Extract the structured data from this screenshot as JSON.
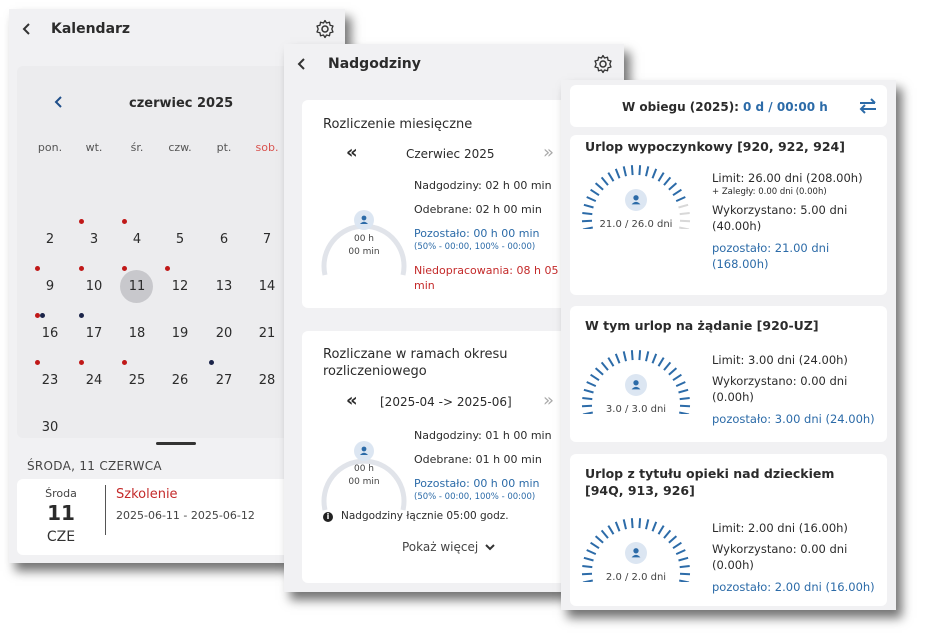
{
  "calendar": {
    "title": "Kalendarz",
    "month_label": "czerwiec 2025",
    "day_names": [
      "pon.",
      "wt.",
      "śr.",
      "czw.",
      "pt.",
      "sob."
    ],
    "weeks": [
      [
        "2",
        "3",
        "4",
        "5",
        "6",
        "7"
      ],
      [
        "9",
        "10",
        "11",
        "12",
        "13",
        "14"
      ],
      [
        "16",
        "17",
        "18",
        "19",
        "20",
        "21"
      ],
      [
        "23",
        "24",
        "25",
        "26",
        "27",
        "28"
      ],
      [
        "30"
      ]
    ],
    "selected_day": "11",
    "selected_date_header": "ŚRODA, 11 CZERWCA",
    "event": {
      "weekday": "Środa",
      "day": "11",
      "month": "CZE",
      "title": "Szkolenie",
      "range": "2025-06-11 - 2025-06-12"
    },
    "colors": {
      "event_red": "#c01818",
      "event_navy": "#1b2449",
      "saturday": "#d9534f"
    }
  },
  "overtime": {
    "title": "Nadgodziny",
    "monthly": {
      "heading": "Rozliczenie miesięczne",
      "period": "Czerwiec 2025",
      "gauge_value": "00 h",
      "gauge_sub": "00 min",
      "overtime": "Nadgodziny: 02 h 00 min",
      "taken": "Odebrane: 02 h 00 min",
      "remaining": "Pozostało: 00 h 00 min",
      "remaining_detail": "(50% - 00:00, 100% - 00:00)",
      "shortfall_line1": "Niedopracowania: 08 h 05",
      "shortfall_line2": "min"
    },
    "settlement": {
      "heading_line1": "Rozliczane w ramach okresu",
      "heading_line2": "rozliczeniowego",
      "period": "[2025-04 -> 2025-06]",
      "gauge_value": "00 h",
      "gauge_sub": "00 min",
      "overtime": "Nadgodziny: 01 h 00 min",
      "taken": "Odebrane: 01 h 00 min",
      "remaining": "Pozostało: 00 h 00 min",
      "remaining_detail": "(50% - 00:00, 100% - 00:00)",
      "total_note": "Nadgodziny łącznie 05:00 godz.",
      "show_more": "Pokaż więcej"
    }
  },
  "leave": {
    "circulation_label": "W obiegu (2025):",
    "circulation_value": "0 d / 00:00 h",
    "cards": [
      {
        "title_line1": "Urlop wypoczynkowy [920, 922, 924]",
        "title_line2": "",
        "gauge": "21.0 / 26.0 dni",
        "fill_fraction": 0.81,
        "limit": "Limit: 26.00 dni (208.00h)",
        "overdue": "+ Zaległy: 0.00 dni (0.00h)",
        "used_line1": "Wykorzystano: 5.00 dni",
        "used_line2": "(40.00h)",
        "remaining_line1": "pozostało: 21.00 dni",
        "remaining_line2": "(168.00h)"
      },
      {
        "title_line1": "W tym urlop na żądanie [920-UZ]",
        "title_line2": "",
        "gauge": "3.0 / 3.0 dni",
        "fill_fraction": 1.0,
        "limit": "Limit: 3.00 dni (24.00h)",
        "overdue": "",
        "used_line1": "Wykorzystano: 0.00 dni",
        "used_line2": "(0.00h)",
        "remaining_line1": "pozostało: 3.00 dni (24.00h)",
        "remaining_line2": ""
      },
      {
        "title_line1": "Urlop z tytułu opieki nad dzieckiem",
        "title_line2": "[94Q, 913, 926]",
        "gauge": "2.0 / 2.0 dni",
        "fill_fraction": 1.0,
        "limit": "Limit: 2.00 dni (16.00h)",
        "overdue": "",
        "used_line1": "Wykorzystano: 0.00 dni",
        "used_line2": "(0.00h)",
        "remaining_line1": "pozostało: 2.00 dni (16.00h)",
        "remaining_line2": ""
      }
    ],
    "colors": {
      "gauge_blue": "#2c6ba8",
      "gauge_gray": "#d8d8d8"
    }
  }
}
